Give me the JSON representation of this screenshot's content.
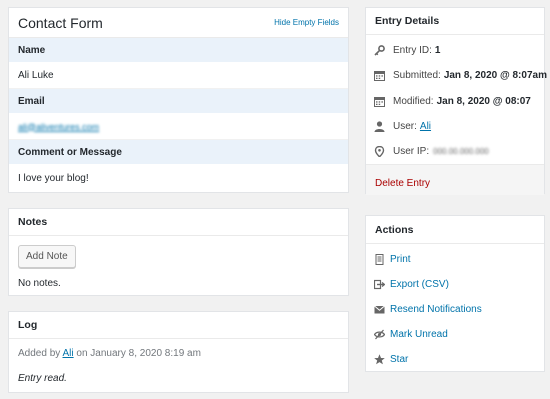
{
  "contact_form": {
    "title": "Contact Form",
    "hide_empty_link": "Hide Empty Fields",
    "fields": [
      {
        "label": "Name",
        "value": "Ali Luke"
      },
      {
        "label": "Email",
        "value": "ali@aliventures.com"
      },
      {
        "label": "Comment or Message",
        "value": "I love your blog!"
      }
    ]
  },
  "notes": {
    "title": "Notes",
    "add_button": "Add Note",
    "empty_text": "No notes."
  },
  "log": {
    "title": "Log",
    "added_by_prefix": "Added by",
    "user": "Ali",
    "added_on": "on January 8, 2020 8:19 am",
    "entry_text": "Entry read."
  },
  "entry_details": {
    "title": "Entry Details",
    "entry_id_label": "Entry ID:",
    "entry_id_value": "1",
    "submitted_label": "Submitted:",
    "submitted_value": "Jan 8, 2020 @ 8:07am",
    "modified_label": "Modified:",
    "modified_value": "Jan 8, 2020 @ 08:07",
    "user_label": "User:",
    "user_value": "Ali",
    "ip_label": "User IP:",
    "ip_value": "000.00.000.000",
    "delete_link": "Delete Entry"
  },
  "actions": {
    "title": "Actions",
    "items": [
      {
        "label": "Print",
        "icon": "print-icon"
      },
      {
        "label": "Export (CSV)",
        "icon": "export-icon"
      },
      {
        "label": "Resend Notifications",
        "icon": "envelope-icon"
      },
      {
        "label": "Mark Unread",
        "icon": "eye-slash-icon"
      },
      {
        "label": "Star",
        "icon": "star-icon"
      }
    ]
  },
  "colors": {
    "link": "#0073aa",
    "delete": "#aa0000",
    "label_bg": "#eaf2fa"
  }
}
